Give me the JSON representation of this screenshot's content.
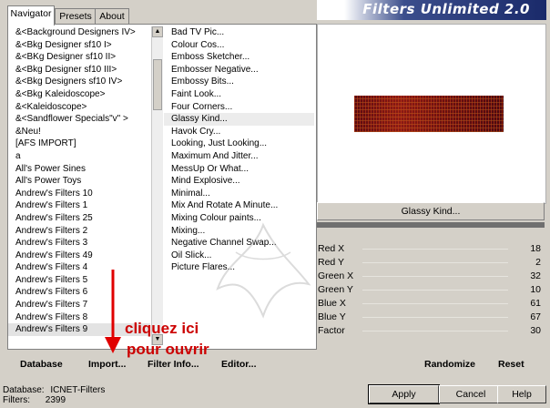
{
  "tabs": [
    "Navigator",
    "Presets",
    "About"
  ],
  "brand": "Filters Unlimited 2.0",
  "categories": {
    "items": [
      "&<Background Designers IV>",
      "&<Bkg Designer sf10 I>",
      "&<BKg Designer sf10 II>",
      "&<Bkg Designer sf10 III>",
      "&<Bkg Designers sf10 IV>",
      "&<Bkg Kaleidoscope>",
      "&<Kaleidoscope>",
      "&<Sandflower Specials\"v\" >",
      "&Neu!",
      "[AFS IMPORT]",
      "a",
      "All's Power Sines",
      "All's Power Toys",
      "Andrew's Filters 10",
      "Andrew's Filters 1",
      "Andrew's Filters 25",
      "Andrew's Filters 2",
      "Andrew's Filters 3",
      "Andrew's Filters 49",
      "Andrew's Filters 4",
      "Andrew's Filters 5",
      "Andrew's Filters 6",
      "Andrew's Filters 7",
      "Andrew's Filters 8",
      "Andrew's Filters 9"
    ]
  },
  "filters": {
    "items": [
      "Bad TV Pic...",
      "Colour Cos...",
      "Emboss Sketcher...",
      "Embosser Negative...",
      "Embossy Bits...",
      "Faint Look...",
      "Four Corners...",
      "Glassy Kind...",
      "Havok Cry...",
      "Looking, Just Looking...",
      "Maximum And Jitter...",
      "MessUp Or What...",
      "Mind Explosive...",
      "Minimal...",
      "Mix And Rotate A Minute...",
      "Mixing Colour paints...",
      "Mixing...",
      "Negative Channel Swap...",
      "Oil Slick...",
      "Picture Flares..."
    ]
  },
  "left_buttons": {
    "database": "Database",
    "import": "Import...",
    "filter_info": "Filter Info...",
    "editor": "Editor..."
  },
  "selected_filter": "Glassy Kind...",
  "params": [
    {
      "label": "Red X",
      "value": "18"
    },
    {
      "label": "Red Y",
      "value": "2"
    },
    {
      "label": "Green X",
      "value": "32"
    },
    {
      "label": "Green Y",
      "value": "10"
    },
    {
      "label": "Blue X",
      "value": "61"
    },
    {
      "label": "Blue Y",
      "value": "67"
    },
    {
      "label": "Factor",
      "value": "30"
    }
  ],
  "right_buttons": {
    "randomize": "Randomize",
    "reset": "Reset"
  },
  "status": {
    "database_label": "Database:",
    "database_value": "ICNET-Filters",
    "filters_label": "Filters:",
    "filters_value": "2399"
  },
  "dialog": {
    "apply": "Apply",
    "cancel": "Cancel",
    "help": "Help"
  },
  "annotation": {
    "line1": "cliquez ici",
    "line2": "pour ouvrir"
  },
  "colors": {
    "annotation": "#cc0000",
    "brand_bg": "#1a2a6a"
  }
}
